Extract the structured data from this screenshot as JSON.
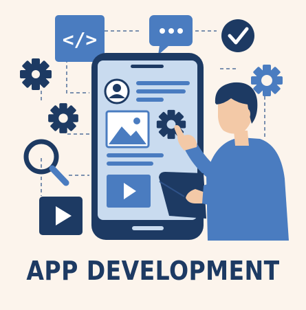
{
  "caption": "APP DEVELOPMENT",
  "code_symbol": "</>",
  "colors": {
    "background": "#fcf4ec",
    "navy": "#1d3a63",
    "blue": "#4a7cc0",
    "light_blue": "#c9dbef",
    "skin": "#f3c9a7",
    "white": "#ffffff"
  },
  "icons": [
    "code-icon",
    "chat-bubble-icon",
    "checkmark-icon",
    "gear-icon",
    "magnifier-icon",
    "play-icon",
    "image-icon",
    "avatar-icon",
    "tablet-icon"
  ]
}
